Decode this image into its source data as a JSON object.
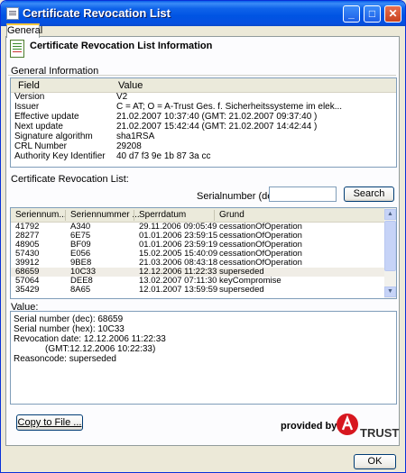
{
  "window": {
    "title": "Certificate Revocation List"
  },
  "tabs": [
    {
      "label": "General"
    }
  ],
  "header": {
    "title": "Certificate Revocation List Information"
  },
  "general_info": {
    "label": "General Information",
    "columns": [
      "Field",
      "Value"
    ],
    "rows": [
      {
        "field": "Version",
        "value": "V2"
      },
      {
        "field": "Issuer",
        "value": "C = AT; O = A-Trust Ges. f. Sicherheitssysteme im elek..."
      },
      {
        "field": "Effective update",
        "value": "21.02.2007 10:37:40  (GMT: 21.02.2007 09:37:40 )"
      },
      {
        "field": "Next update",
        "value": "21.02.2007 15:42:44  (GMT: 21.02.2007 14:42:44 )"
      },
      {
        "field": "Signature algorithm",
        "value": "sha1RSA"
      },
      {
        "field": "CRL Number",
        "value": "29208"
      },
      {
        "field": "Authority Key Identifier",
        "value": "40 d7 f3 9e 1b 87 3a cc"
      }
    ]
  },
  "crl": {
    "label": "Certificate Revocation List:",
    "search_label": "Serialnumber (dec):",
    "search_value": "",
    "search_button": "Search",
    "columns": [
      "Seriennum...",
      "Seriennummer ...",
      "Sperrdatum",
      "Grund"
    ],
    "rows": [
      [
        "41792",
        "A340",
        "29.11.2006 09:05:49",
        "cessationOfOperation"
      ],
      [
        "28277",
        "6E75",
        "01.01.2006 23:59:15",
        "cessationOfOperation"
      ],
      [
        "48905",
        "BF09",
        "01.01.2006 23:59:19",
        "cessationOfOperation"
      ],
      [
        "57430",
        "E056",
        "15.02.2005 15:40:09",
        "cessationOfOperation"
      ],
      [
        "39912",
        "9BE8",
        "21.03.2006 08:43:18",
        "cessationOfOperation"
      ],
      [
        "68659",
        "10C33",
        "12.12.2006 11:22:33",
        "superseded"
      ],
      [
        "57064",
        "DEE8",
        "13.02.2007 07:11:30",
        "keyCompromise"
      ],
      [
        "35429",
        "8A65",
        "12.01.2007 13:59:59",
        "superseded"
      ]
    ]
  },
  "value": {
    "label": "Value:",
    "lines": [
      "Serial number (dec):  68659",
      "Serial number (hex):  10C33",
      "Revocation date:  12.12.2006 11:22:33",
      "(GMT:12.12.2006 10:22:33)",
      "Reasoncode:  superseded"
    ]
  },
  "footer": {
    "copy_button": "Copy to File ...",
    "provided_by": "provided by",
    "logo_text": "TRUST",
    "ok_button": "OK"
  }
}
